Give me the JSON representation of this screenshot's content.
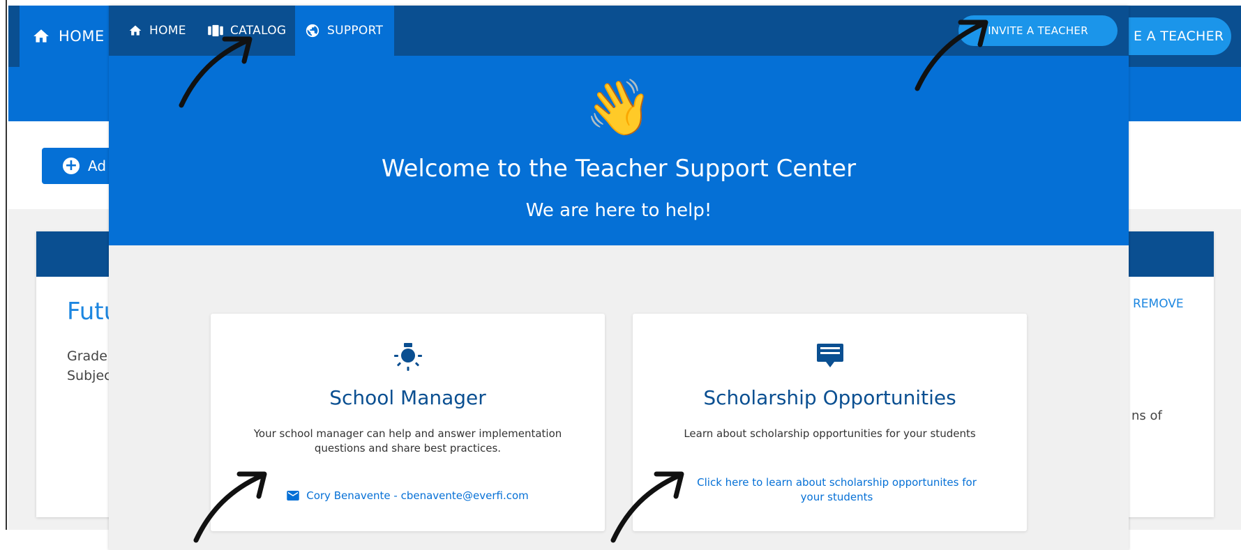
{
  "background": {
    "nav_home_label": "HOME",
    "invite_label": "E A TEACHER",
    "add_button_label": "Ad",
    "card_title": "Futu",
    "grade_label": "Grade:",
    "subject_label": "Subjec",
    "remove_label": "REMOVE",
    "trailing_text": "ns of"
  },
  "nav": {
    "items": [
      {
        "label": "HOME",
        "icon": "home-icon"
      },
      {
        "label": "CATALOG",
        "icon": "catalog-icon"
      },
      {
        "label": "SUPPORT",
        "icon": "globe-icon"
      }
    ],
    "active": "SUPPORT",
    "invite_button": "INVITE A TEACHER"
  },
  "hero": {
    "emoji": "👋",
    "title": "Welcome to the Teacher Support Center",
    "subtitle": "We are here to help!"
  },
  "cards": [
    {
      "icon": "lightbulb-icon",
      "title": "School Manager",
      "description": "Your school manager can help and answer implementation questions and share best practices.",
      "contact": "Cory Benavente - cbenavente@everfi.com"
    },
    {
      "icon": "certificate-icon",
      "title": "Scholarship Opportunities",
      "description": "Learn about scholarship opportunities for your students",
      "link": "Click here to learn about scholarship opportunites for your students"
    }
  ],
  "colors": {
    "dark_blue": "#0a4f91",
    "primary_blue": "#0570d6",
    "light_blue": "#1b95ea",
    "page_gray": "#f0f0f0"
  }
}
